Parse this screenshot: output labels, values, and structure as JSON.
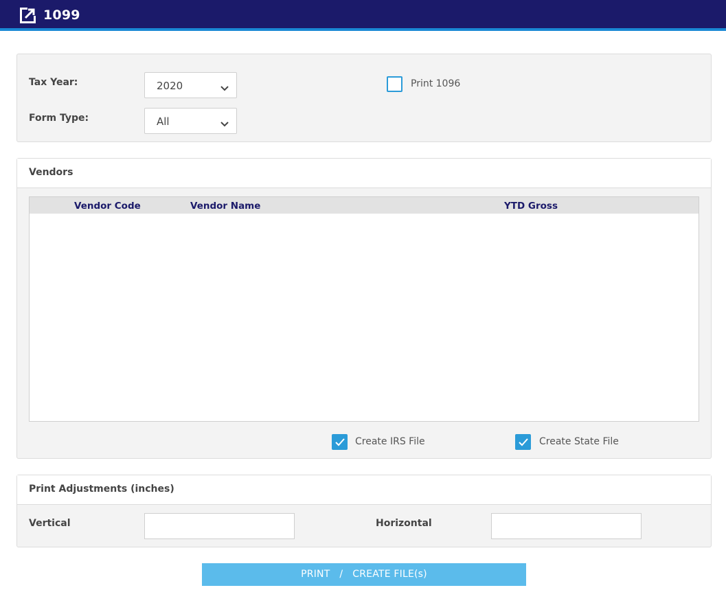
{
  "header": {
    "title": "1099",
    "icon": "external-link-icon"
  },
  "filters": {
    "tax_year_label": "Tax Year:",
    "tax_year_value": "2020",
    "form_type_label": "Form Type:",
    "form_type_value": "All",
    "print_1096_label": "Print 1096",
    "print_1096_checked": false
  },
  "vendors": {
    "title": "Vendors",
    "columns": [
      "Vendor Code",
      "Vendor Name",
      "YTD Gross"
    ],
    "rows": [],
    "create_irs_label": "Create IRS File",
    "create_irs_checked": true,
    "create_state_label": "Create State File",
    "create_state_checked": true
  },
  "adjustments": {
    "title": "Print Adjustments (inches)",
    "vertical_label": "Vertical",
    "vertical_value": "",
    "horizontal_label": "Horizontal",
    "horizontal_value": ""
  },
  "actions": {
    "print_label": "PRINT   /   CREATE FILE(s)"
  },
  "colors": {
    "header_bg": "#1b1a6a",
    "accent": "#2b9bd8",
    "button_bg": "#5bbbeb"
  }
}
